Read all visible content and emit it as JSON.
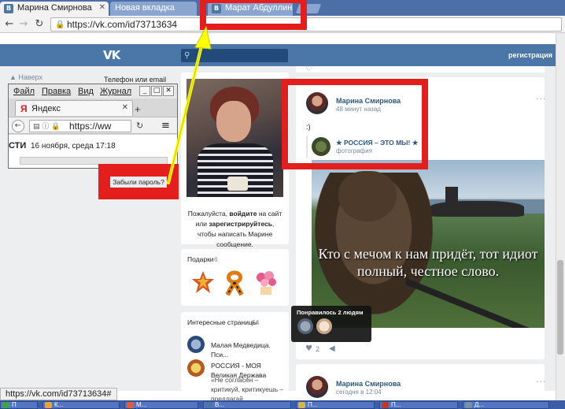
{
  "browser": {
    "tabs": [
      {
        "label": "Марина Смирнова",
        "active": true
      },
      {
        "label": "Новая вкладка",
        "active": false
      },
      {
        "label": "Марат Абдуллин",
        "active": false
      }
    ],
    "address": "https://vk.com/id73713634",
    "status_url": "https://vk.com/id73713634#"
  },
  "vk_header": {
    "logo": "vk",
    "search_placeholder": "",
    "register_label": "регистрация"
  },
  "sidebar": {
    "back_label": "Наверх",
    "login_label": "Телефон или email",
    "forgot_label": "Забыли пароль?"
  },
  "yandex_window": {
    "menu": [
      "Файл",
      "Правка",
      "Вид",
      "Журнал"
    ],
    "tab_title": "Яндекс",
    "address": "https://ww",
    "page_prefix": "СТИ",
    "page_date": "16 ноября, среда 17:18"
  },
  "profile": {
    "msg_part1": "Пожалуйста, ",
    "msg_link1": "войдите",
    "msg_part2": " на сайт или ",
    "msg_link2": "зарегистрируйтесь",
    "msg_part3": ", чтобы написать Марине сообщение."
  },
  "gifts": {
    "title": "Подарки",
    "count": "6"
  },
  "interesting": {
    "title": "Интересные страницы",
    "count": "64",
    "items": [
      {
        "name": "Малая Медведица. Пси..."
      },
      {
        "name": "РОССИЯ - МОЯ Великая Держава",
        "quote": "«Не согласен – критикуй, критикуешь – предлагай, предлагаешь – делай,"
      }
    ]
  },
  "post": {
    "author": "Марина Смирнова",
    "time": "48 минут назад",
    "text": ":)",
    "repost_name": "★ РОССИЯ – ЭТО МЫ! ★",
    "repost_type": "фотография",
    "image_caption": "Кто с мечом к нам придёт, тот идиот полный, честное слово.",
    "likes_tooltip": "Понравилось 2 людям",
    "likes": "2",
    "more": "···"
  },
  "post2": {
    "author": "Марина Смирнова",
    "time": "сегодня в 12:04",
    "more": "···"
  },
  "taskbar": {
    "items": [
      "П",
      "К...",
      "М...",
      "В...",
      "П...",
      "П...",
      "Д..."
    ]
  },
  "colors": {
    "vk_blue": "#4a76a8",
    "annotation_red": "#e41d1d",
    "annotation_arrow": "#ffff00"
  }
}
